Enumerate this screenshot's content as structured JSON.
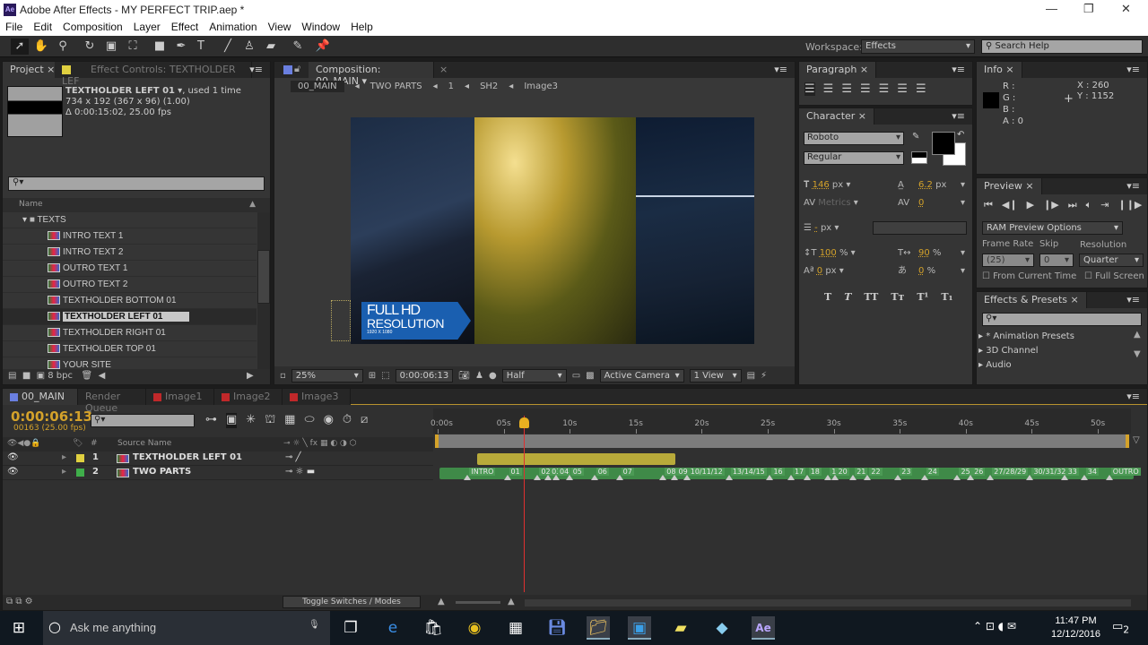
{
  "window": {
    "app_icon": "Ae",
    "title": "Adobe After Effects - MY PERFECT TRIP.aep *"
  },
  "menu": [
    "File",
    "Edit",
    "Composition",
    "Layer",
    "Effect",
    "Animation",
    "View",
    "Window",
    "Help"
  ],
  "workspace": {
    "label": "Workspace:",
    "value": "Effects",
    "search_placeholder": "Search Help"
  },
  "project": {
    "tab": "Project",
    "effect_tab": "Effect Controls: TEXTHOLDER LEF",
    "selected_name": "TEXTHOLDER LEFT 01",
    "used": ", used 1 time",
    "dims": "734 x 192  (367 x 96) (1.00)",
    "duration": "Δ 0:00:15:02, 25.00 fps",
    "col_name": "Name",
    "folder": "TEXTS",
    "items": [
      "INTRO TEXT 1",
      "INTRO TEXT 2",
      "OUTRO TEXT 1",
      "OUTRO TEXT 2",
      "TEXTHOLDER BOTTOM 01",
      "TEXTHOLDER LEFT 01",
      "TEXTHOLDER RIGHT 01",
      "TEXTHOLDER TOP 01",
      "YOUR SITE"
    ],
    "bpc": "8 bpc"
  },
  "comp": {
    "tab": "Composition: 00_MAIN",
    "breadcrumb": [
      "00_MAIN",
      "TWO PARTS",
      "1",
      "SH2",
      "Image3"
    ],
    "overlay_line1": "FULL HD",
    "overlay_line2": "RESOLUTION",
    "overlay_line3": "1920 X 1080",
    "zoom": "25%",
    "timecode": "0:00:06:13",
    "resolution": "Half",
    "camera": "Active Camera",
    "views": "1 View"
  },
  "paragraph": {
    "tab": "Paragraph"
  },
  "character": {
    "tab": "Character",
    "font": "Roboto",
    "style": "Regular",
    "size": "146",
    "size_unit": "px",
    "leading": "6.2",
    "leading_unit": "px",
    "kerning": "Metrics",
    "tracking": "0",
    "stroke": "-",
    "stroke_unit": "px",
    "vscale": "100",
    "vscale_unit": "%",
    "hscale": "90",
    "hscale_unit": "%",
    "baseline": "0",
    "baseline_unit": "px",
    "tsume": "0",
    "tsume_unit": "%",
    "styles": [
      "T",
      "T",
      "TT",
      "Tт",
      "T¹",
      "T₁"
    ]
  },
  "info": {
    "tab": "Info",
    "r": "R :",
    "g": "G :",
    "b": "B :",
    "a": "A : 0",
    "x": "X : 260",
    "y": "Y : 1152"
  },
  "preview": {
    "tab": "Preview",
    "ram": "RAM Preview Options",
    "frame_rate_label": "Frame Rate",
    "skip_label": "Skip",
    "resolution_label": "Resolution",
    "frame_rate": "(25)",
    "skip": "0",
    "resolution": "Quarter",
    "from_current": "From Current Time",
    "full_screen": "Full Screen"
  },
  "effects": {
    "tab": "Effects & Presets",
    "items": [
      "* Animation Presets",
      "3D Channel",
      "Audio"
    ]
  },
  "timeline": {
    "tabs": [
      {
        "label": "00_MAIN",
        "color": "#6a7fe0"
      },
      {
        "label": "Render Queue",
        "color": ""
      },
      {
        "label": "Image1",
        "color": "#c0282a"
      },
      {
        "label": "Image2",
        "color": "#c0282a"
      },
      {
        "label": "Image3",
        "color": "#c0282a"
      }
    ],
    "timecode": "0:00:06:13",
    "frames": "00163 (25.00 fps)",
    "col_source": "Source Name",
    "col_num": "#",
    "layers": [
      {
        "num": "1",
        "name": "TEXTHOLDER LEFT 01",
        "color": "#e0d040",
        "start": 3,
        "end": 18
      },
      {
        "num": "2",
        "name": "TWO PARTS",
        "color": "#3fae4a",
        "start": 0,
        "end": 53
      }
    ],
    "ruler_labels": [
      "0:00s",
      "05s",
      "10s",
      "15s",
      "20s",
      "25s",
      "30s",
      "35s",
      "40s",
      "45s",
      "50s"
    ],
    "current_time_s": 6.52,
    "comp_marker": "1",
    "markers": [
      {
        "t": 2.2,
        "l": "INTRO"
      },
      {
        "t": 5.2,
        "l": "01"
      },
      {
        "t": 7.5,
        "l": "02"
      },
      {
        "t": 8.3,
        "l": "03"
      },
      {
        "t": 8.9,
        "l": "04"
      },
      {
        "t": 9.9,
        "l": "05"
      },
      {
        "t": 11.8,
        "l": "06"
      },
      {
        "t": 13.7,
        "l": "07"
      },
      {
        "t": 17.0,
        "l": "08"
      },
      {
        "t": 17.9,
        "l": "09"
      },
      {
        "t": 18.8,
        "l": "10/11/12"
      },
      {
        "t": 22.0,
        "l": "13/14/15"
      },
      {
        "t": 25.1,
        "l": "16"
      },
      {
        "t": 26.7,
        "l": "17"
      },
      {
        "t": 27.9,
        "l": "18"
      },
      {
        "t": 29.5,
        "l": "19"
      },
      {
        "t": 30.0,
        "l": "20"
      },
      {
        "t": 31.4,
        "l": "21"
      },
      {
        "t": 32.5,
        "l": "22"
      },
      {
        "t": 34.8,
        "l": "23"
      },
      {
        "t": 36.8,
        "l": "24"
      },
      {
        "t": 39.3,
        "l": "25"
      },
      {
        "t": 40.3,
        "l": "26"
      },
      {
        "t": 41.8,
        "l": "27/28/29"
      },
      {
        "t": 44.8,
        "l": "30/31/32"
      },
      {
        "t": 47.4,
        "l": "33"
      },
      {
        "t": 48.9,
        "l": "34"
      },
      {
        "t": 50.8,
        "l": "OUTRO"
      }
    ],
    "toggle": "Toggle Switches / Modes"
  },
  "taskbar": {
    "search": "Ask me anything",
    "time": "11:47 PM",
    "date": "12/12/2016",
    "notif": "2"
  }
}
